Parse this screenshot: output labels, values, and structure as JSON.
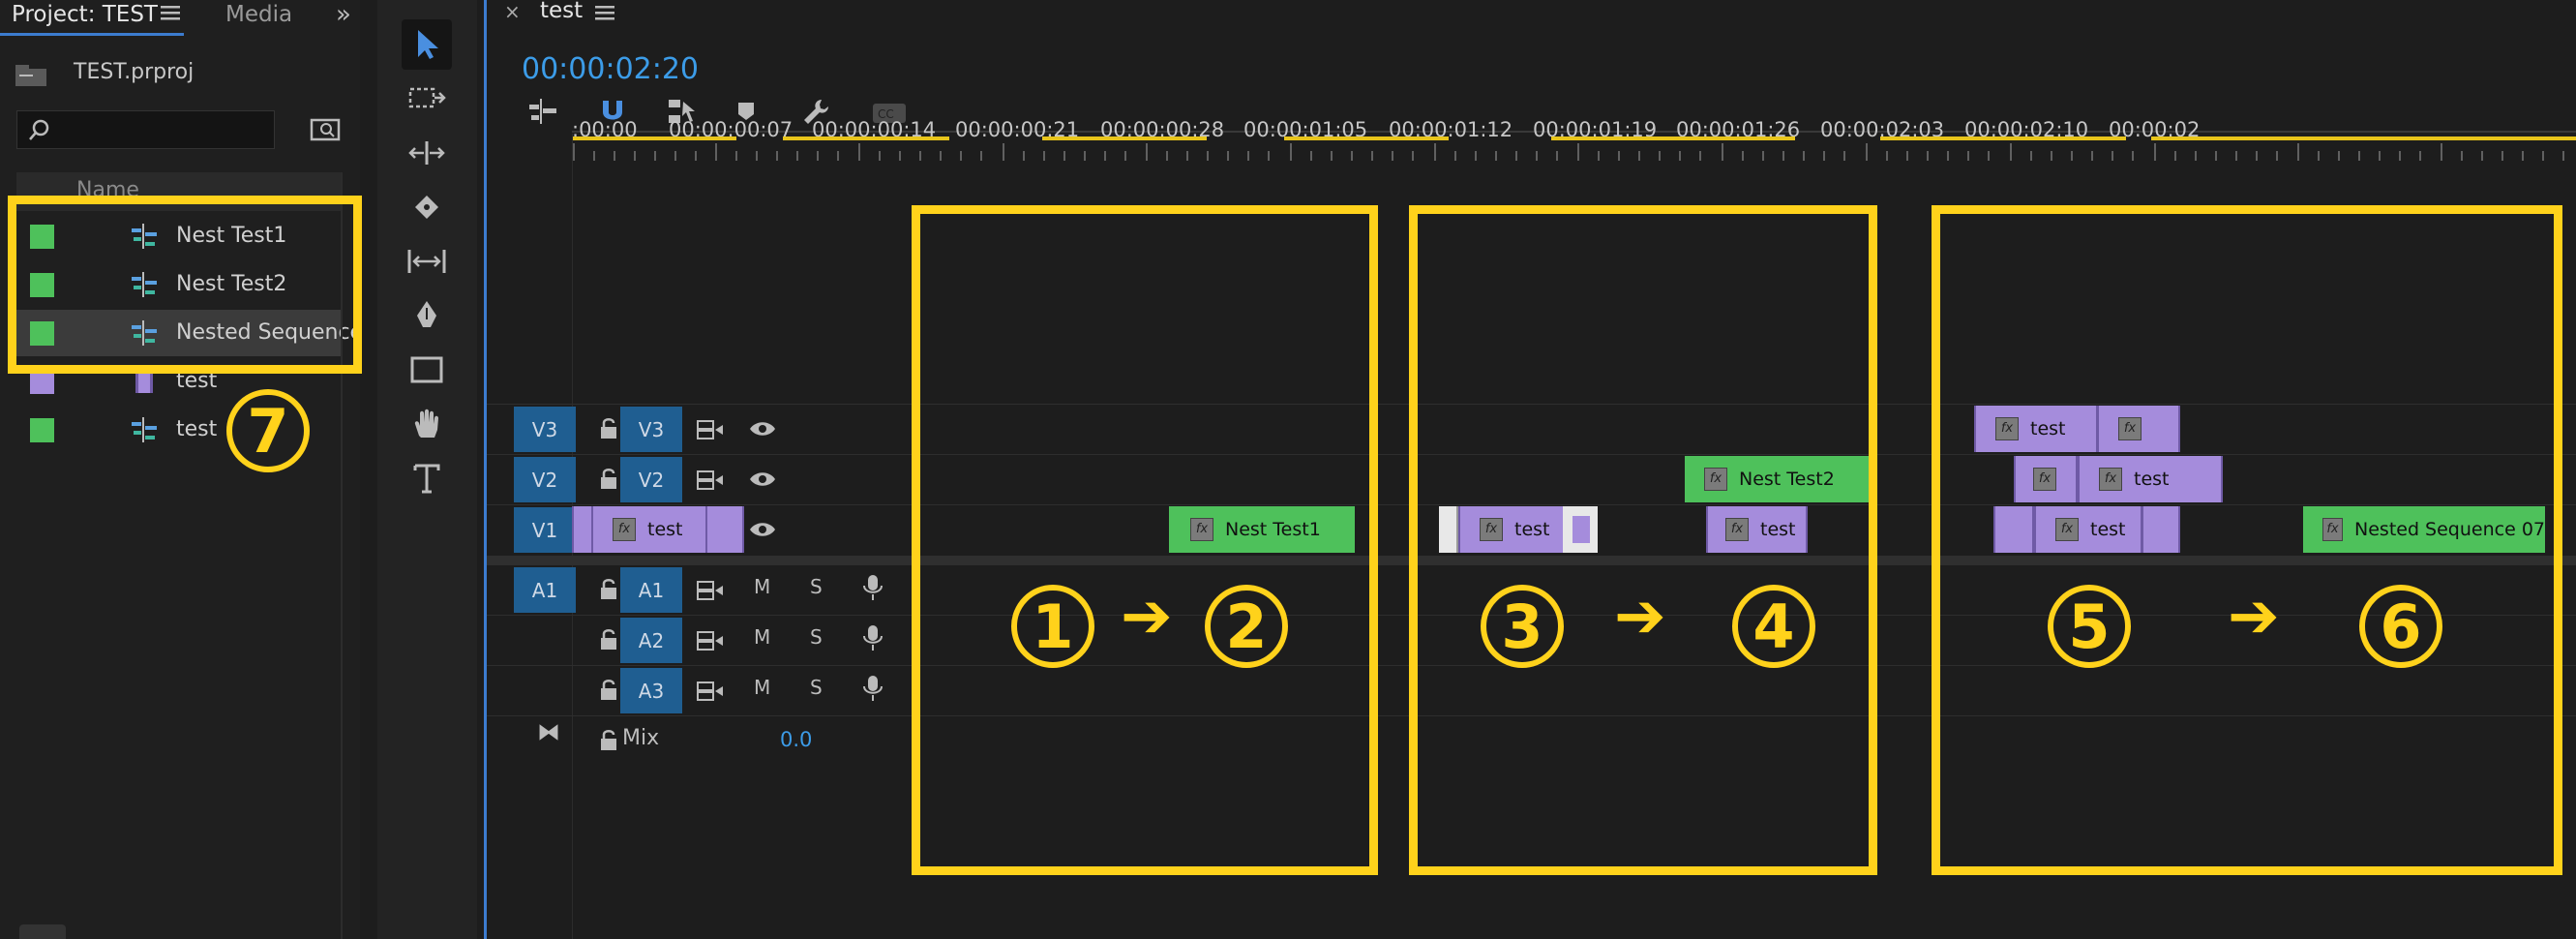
{
  "project": {
    "tab_project": "Project: TEST",
    "tab_media": "Media",
    "file_name": "TEST.prproj",
    "column_header": "Name",
    "items": [
      {
        "label": "Nest Test1",
        "color": "#4ec15b",
        "type": "sequence"
      },
      {
        "label": "Nest Test2",
        "color": "#4ec15b",
        "type": "sequence"
      },
      {
        "label": "Nested Sequence",
        "color": "#4ec15b",
        "type": "sequence"
      },
      {
        "label": "test",
        "color": "#a58cdc",
        "type": "clip"
      },
      {
        "label": "test",
        "color": "#4ec15b",
        "type": "sequence"
      }
    ]
  },
  "timeline": {
    "sequence_tab": "test",
    "timecode": "00:00:02:20",
    "ruler_ticks": [
      ":00:00",
      "00:00:00:07",
      "00:00:00:14",
      "00:00:00:21",
      "00:00:00:28",
      "00:00:01:05",
      "00:00:01:12",
      "00:00:01:19",
      "00:00:01:26",
      "00:00:02:03",
      "00:00:02:10",
      "00:00:02"
    ],
    "video_tracks": [
      {
        "src": "V3",
        "name": "V3"
      },
      {
        "src": "V2",
        "name": "V2"
      },
      {
        "src": "V1",
        "name": "V1"
      }
    ],
    "audio_tracks": [
      {
        "src": "A1",
        "name": "A1",
        "m": "M",
        "s": "S"
      },
      {
        "src": "",
        "name": "A2",
        "m": "M",
        "s": "S"
      },
      {
        "src": "",
        "name": "A3",
        "m": "M",
        "s": "S"
      }
    ],
    "mix_label": "Mix",
    "mix_value": "0.0",
    "clips": {
      "c1_test": "test",
      "c2_nest1": "Nest Test1",
      "c3_test": "test",
      "c4_nest2": "Nest Test2",
      "c4_test": "test",
      "c5_v3_test": "test",
      "c5_v2_test": "test",
      "c5_v1_test": "test",
      "c6_nested": "Nested Sequence 07"
    },
    "fx_badge": "fx"
  },
  "annotations": {
    "steps": [
      "1",
      "2",
      "3",
      "4",
      "5",
      "6",
      "7"
    ],
    "arrow": "➔",
    "color": "#ffd21b"
  }
}
